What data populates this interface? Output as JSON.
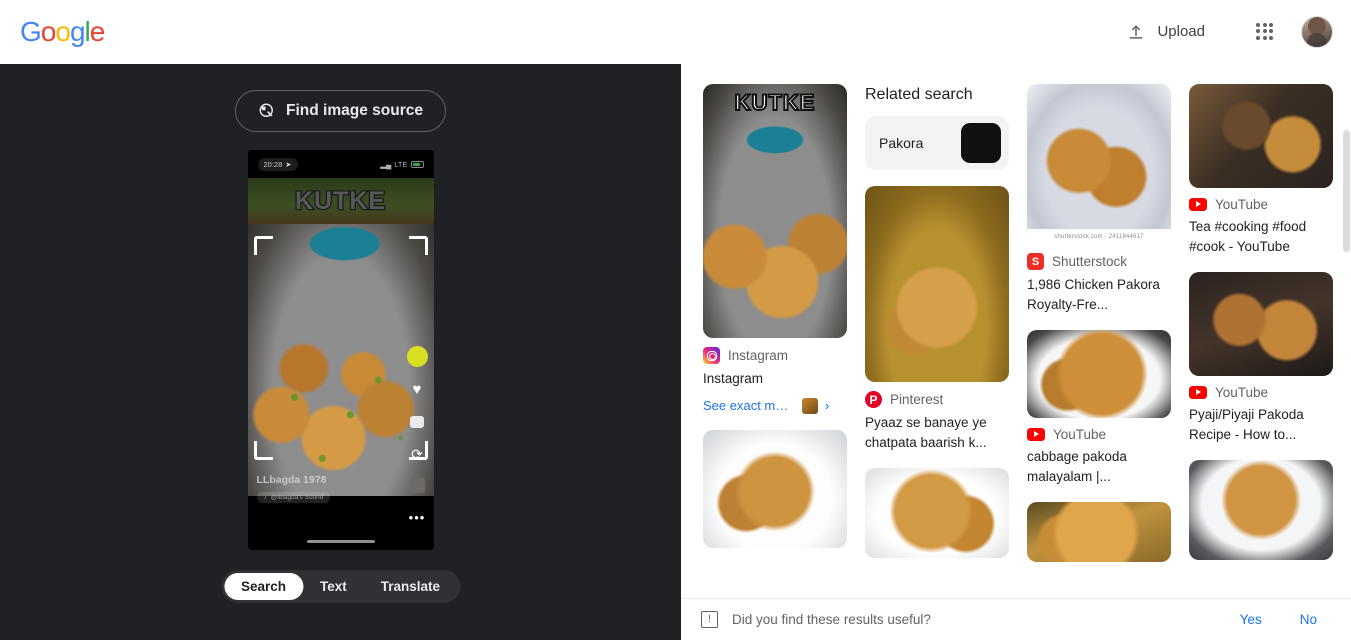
{
  "header": {
    "logo_letters": [
      {
        "ch": "G",
        "color": "#4285F4"
      },
      {
        "ch": "o",
        "color": "#EA4335"
      },
      {
        "ch": "o",
        "color": "#FBBC05"
      },
      {
        "ch": "g",
        "color": "#4285F4"
      },
      {
        "ch": "l",
        "color": "#34A853"
      },
      {
        "ch": "e",
        "color": "#EA4335"
      }
    ],
    "upload_label": "Upload",
    "upload_icon": "upload-icon",
    "apps_icon": "apps-grid-icon",
    "avatar_icon": "user-avatar"
  },
  "left_panel": {
    "find_image_source_label": "Find image source",
    "find_image_source_icon": "image-search-icon",
    "phone_screenshot": {
      "status_time": "20:28",
      "status_location_icon": "location-arrow-icon",
      "carrier_label": "LTE",
      "overlay_word": "KUTKE",
      "username": "LLbagda 1978",
      "sound_label": "@llbagda's Sound",
      "rail_icons": [
        "lightbulb-icon",
        "heart-icon",
        "comment-icon",
        "share-icon",
        "thumb-icon",
        "more-icon"
      ],
      "crop_handles": [
        "crop-handle-top-left",
        "crop-handle-top-right",
        "crop-handle-bottom-left",
        "crop-handle-bottom-right"
      ]
    },
    "mode_tabs": [
      {
        "label": "Search",
        "active": true
      },
      {
        "label": "Text",
        "active": false
      },
      {
        "label": "Translate",
        "active": false
      }
    ]
  },
  "results": {
    "related_search_heading": "Related search",
    "related_chips": [
      {
        "label": "Pakora"
      }
    ],
    "column_1": [
      {
        "source": "Instagram",
        "favicon": "instagram-icon",
        "title": "Instagram",
        "exact_match_label": "See exact matc...",
        "thumb_style": "food-a",
        "thumb_height": 254,
        "overlay_word": "KUTKE"
      },
      {
        "source": "",
        "favicon": "",
        "title": "",
        "thumb_style": "food-d",
        "thumb_height": 118
      }
    ],
    "column_2": [
      {
        "source": "Pinterest",
        "favicon": "pinterest-icon",
        "title": "Pyaaz se banaye ye chatpata baarish k...",
        "thumb_style": "food-b",
        "thumb_height": 196
      },
      {
        "source": "",
        "favicon": "",
        "title": "",
        "thumb_style": "food-e",
        "thumb_height": 90
      }
    ],
    "column_3": [
      {
        "source": "Shutterstock",
        "favicon": "shutterstock-icon",
        "title": "1,986 Chicken Pakora Royalty-Fre...",
        "thumb_style": "food-c",
        "thumb_height": 160,
        "watermark": "shutterstock.com · 2411844617"
      },
      {
        "source": "YouTube",
        "favicon": "youtube-icon",
        "title": "cabbage pakoda malayalam |...",
        "thumb_style": "food-f",
        "thumb_height": 88
      },
      {
        "source": "",
        "favicon": "",
        "title": "",
        "thumb_style": "food-i",
        "thumb_height": 60
      }
    ],
    "column_4": [
      {
        "source": "YouTube",
        "favicon": "youtube-icon",
        "title": "Tea #cooking #food #cook - YouTube",
        "thumb_style": "food-g",
        "thumb_height": 104
      },
      {
        "source": "YouTube",
        "favicon": "youtube-icon",
        "title": "Pyaji/Piyaji Pakoda Recipe - How to...",
        "thumb_style": "food-h",
        "thumb_height": 104
      },
      {
        "source": "",
        "favicon": "",
        "title": "",
        "thumb_style": "food-j",
        "thumb_height": 100
      }
    ]
  },
  "footer": {
    "feedback_icon": "feedback-icon",
    "question": "Did you find these results useful?",
    "yes_label": "Yes",
    "no_label": "No"
  }
}
